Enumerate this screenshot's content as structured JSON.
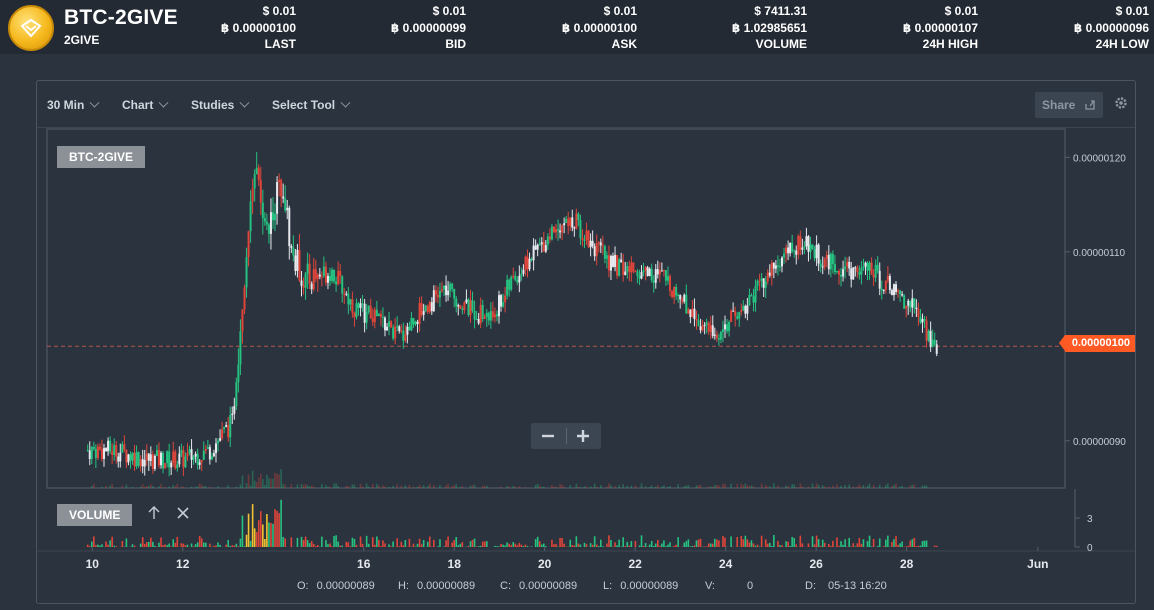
{
  "header": {
    "pair": "BTC-2GIVE",
    "coin": "2GIVE",
    "stats": [
      {
        "usd": "$ 0.01",
        "btc": "฿ 0.00000100",
        "label": "LAST"
      },
      {
        "usd": "$ 0.01",
        "btc": "฿ 0.00000099",
        "label": "BID"
      },
      {
        "usd": "$ 0.01",
        "btc": "฿ 0.00000100",
        "label": "ASK"
      },
      {
        "usd": "$ 7411.31",
        "btc": "฿ 1.02985651",
        "label": "VOLUME"
      },
      {
        "usd": "$ 0.01",
        "btc": "฿ 0.00000107",
        "label": "24H HIGH"
      },
      {
        "usd": "$ 0.01",
        "btc": "฿ 0.00000096",
        "label": "24H LOW"
      }
    ]
  },
  "toolbar": {
    "interval": "30 Min",
    "chart": "Chart",
    "studies": "Studies",
    "tool": "Select Tool",
    "share": "Share"
  },
  "chart": {
    "symbol_tag": "BTC-2GIVE",
    "volume_tag": "VOLUME",
    "current_price_tag": "0.00000100",
    "price_ticks": [
      "0.00000120",
      "0.00000110",
      "0.00000090"
    ],
    "volume_ticks": [
      "3",
      "0"
    ],
    "x_ticks": [
      "10",
      "12",
      "16",
      "18",
      "20",
      "22",
      "24",
      "26",
      "28",
      "Jun"
    ]
  },
  "ohlc": {
    "o_label": "O:",
    "o": "0.00000089",
    "h_label": "H:",
    "h": "0.00000089",
    "c_label": "C:",
    "c": "0.00000089",
    "l_label": "L:",
    "l": "0.00000089",
    "v_label": "V:",
    "v": "0",
    "d_label": "D:",
    "d": "05-13 16:20"
  },
  "colors": {
    "up": "#26c281",
    "down": "#e0453a",
    "accent": "#ff5a23",
    "candle_white": "#e6e9ee"
  },
  "chart_data": {
    "type": "candlestick",
    "series": [
      {
        "values": [
          [
            9.9,
            8.9e-07
          ],
          [
            10.5,
            8.9e-07
          ],
          [
            11.2,
            8.8e-07
          ],
          [
            12.0,
            8.8e-07
          ],
          [
            12.6,
            8.9e-07
          ],
          [
            13.1,
            9.2e-07
          ],
          [
            13.4,
            1.1e-06
          ],
          [
            13.6,
            1.18e-06
          ],
          [
            13.9,
            1.13e-06
          ],
          [
            14.2,
            1.18e-06
          ],
          [
            14.4,
            1.1e-06
          ],
          [
            14.7,
            1.07e-06
          ],
          [
            15.3,
            1.08e-06
          ],
          [
            15.8,
            1.04e-06
          ],
          [
            16.3,
            1.03e-06
          ],
          [
            16.8,
            1.01e-06
          ],
          [
            17.3,
            1.04e-06
          ],
          [
            17.8,
            1.06e-06
          ],
          [
            18.3,
            1.04e-06
          ],
          [
            18.8,
            1.03e-06
          ],
          [
            19.3,
            1.07e-06
          ],
          [
            19.8,
            1.1e-06
          ],
          [
            20.3,
            1.13e-06
          ],
          [
            20.7,
            1.13e-06
          ],
          [
            21.2,
            1.1e-06
          ],
          [
            21.7,
            1.08e-06
          ],
          [
            22.2,
            1.08e-06
          ],
          [
            22.7,
            1.07e-06
          ],
          [
            23.2,
            1.04e-06
          ],
          [
            23.7,
            1.01e-06
          ],
          [
            24.2,
            1.03e-06
          ],
          [
            24.7,
            1.06e-06
          ],
          [
            25.2,
            1.09e-06
          ],
          [
            25.7,
            1.11e-06
          ],
          [
            26.2,
            1.09e-06
          ],
          [
            26.7,
            1.08e-06
          ],
          [
            27.2,
            1.08e-06
          ],
          [
            27.7,
            1.06e-06
          ],
          [
            28.2,
            1.04e-06
          ],
          [
            28.7,
            9.9e-07
          ]
        ]
      }
    ],
    "ylim": [
      8.5e-07,
      1.23e-06
    ],
    "xlim": [
      9.0,
      31.5
    ],
    "current": 1e-06
  }
}
